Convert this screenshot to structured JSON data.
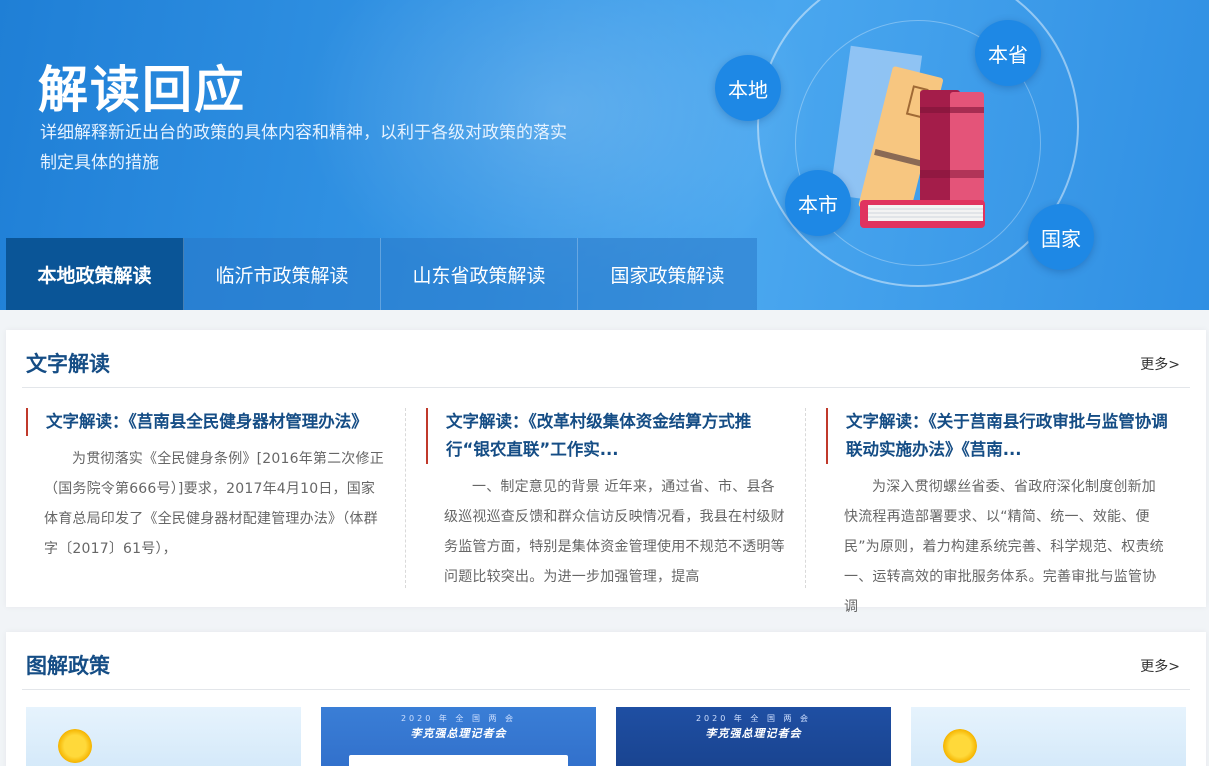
{
  "banner": {
    "title": "解读回应",
    "description": "详细解释新近出台的政策的具体内容和精神，以利于各级对政策的落实制定具体的措施",
    "bubbles": {
      "local": "本地",
      "province": "本省",
      "city": "本市",
      "nation": "国家"
    }
  },
  "tabs": [
    {
      "label": "本地政策解读",
      "active": true
    },
    {
      "label": "临沂市政策解读"
    },
    {
      "label": "山东省政策解读"
    },
    {
      "label": "国家政策解读"
    }
  ],
  "text_section": {
    "title": "文字解读",
    "more": "更多>",
    "articles": [
      {
        "title": "文字解读：《莒南县全民健身器材管理办法》",
        "body": "为贯彻落实《全民健身条例》[2016年第二次修正（国务院令第666号）]要求，2017年4月10日，国家体育总局印发了《全民健身器材配建管理办法》（体群字〔2017〕61号），"
      },
      {
        "title": "文字解读：《改革村级集体资金结算方式推行“银农直联”工作实...",
        "body": "一、制定意见的背景 近年来，通过省、市、县各级巡视巡查反馈和群众信访反映情况看，我县在村级财务监管方面，特别是集体资金管理使用不规范不透明等问题比较突出。为进一步加强管理，提高"
      },
      {
        "title": "文字解读：《关于莒南县行政审批与监管协调联动实施办法》《莒南...",
        "body": "为深入贯彻螺丝省委、省政府深化制度创新加快流程再造部署要求、以“精简、统一、效能、便民”为原则，着力构建系统完善、科学规范、权责统一、运转高效的审批服务体系。完善审批与监管协调"
      }
    ]
  },
  "image_section": {
    "title": "图解政策",
    "more": "更多>",
    "thumbs": [
      {
        "kind": "sky"
      },
      {
        "kind": "conference",
        "small": "2020 年 全 国 两 会",
        "big": "李克强总理记者会"
      },
      {
        "kind": "conference",
        "small": "2020 年 全 国 两 会",
        "big": "李克强总理记者会"
      },
      {
        "kind": "sky"
      }
    ]
  },
  "colors": {
    "primary": "#154d85",
    "tab_active": "#0a5597",
    "accent_red": "#c0392b",
    "banner_blue": "#3596e6"
  }
}
